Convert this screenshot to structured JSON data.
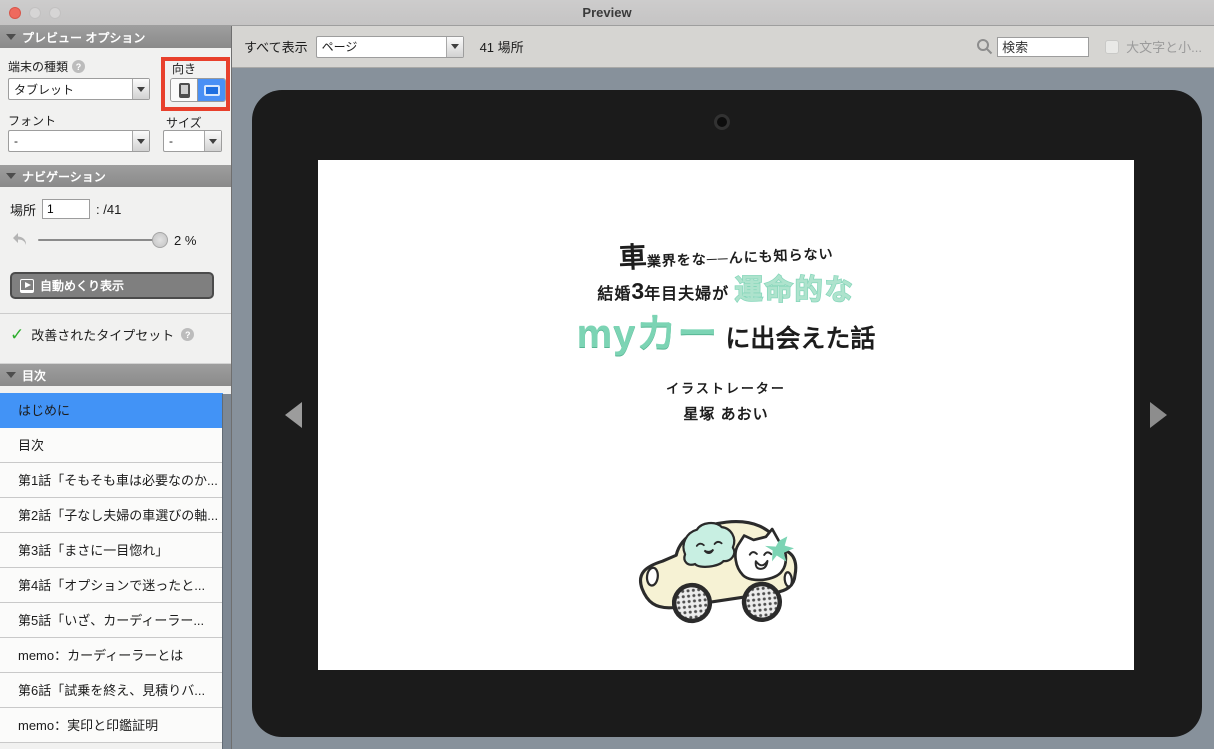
{
  "window": {
    "title": "Preview"
  },
  "sidebar": {
    "preview_options": {
      "header": "プレビュー オプション",
      "device_type_label": "端末の種類",
      "device_type_value": "タブレット",
      "orientation_label": "向き",
      "font_label": "フォント",
      "font_value": "-",
      "size_label": "サイズ",
      "size_value": "-"
    },
    "navigation": {
      "header": "ナビゲーション",
      "location_label": "場所",
      "location_value": "1",
      "location_total": ": /41",
      "progress_percent": "2 %",
      "auto_flip_button": "自動めくり表示",
      "typeset_label": "改善されたタイプセット"
    },
    "toc": {
      "header": "目次",
      "items": [
        {
          "label": "はじめに"
        },
        {
          "label": "目次"
        },
        {
          "label": "第1話「そもそも車は必要なのか..."
        },
        {
          "label": "第2話「子なし夫婦の車選びの軸..."
        },
        {
          "label": "第3話「まさに一目惚れ」"
        },
        {
          "label": "第4話「オプションで迷ったと..."
        },
        {
          "label": "第5話「いざ、カーディーラー..."
        },
        {
          "label": "memo：カーディーラーとは"
        },
        {
          "label": "第6話「試乗を終え、見積りバ..."
        },
        {
          "label": "memo：実印と印鑑証明"
        }
      ]
    }
  },
  "toolbar": {
    "show_all_label": "すべて表示",
    "view_mode_value": "ページ",
    "location_count": "41 場所",
    "search_value": "検索",
    "case_label": "大文字と小..."
  },
  "book_page": {
    "title_line1_big": "車",
    "title_line1_rest": "業界をな──んにも知らない",
    "title_line2_black_a": "結婚",
    "title_line2_num": "3",
    "title_line2_black_b": "年目夫婦が ",
    "title_line2_mint": "運命的な",
    "title_line3_mint": "myカー",
    "title_line3_black": " に出会えた話",
    "author_role": "イラストレーター",
    "author_name": "星塚 あおい"
  },
  "colors": {
    "selection_blue": "#4293f6",
    "annotation_red": "#e8402c",
    "mint_green": "#7cd4b4",
    "tablet_bezel": "#1b1b1b",
    "workspace_gray": "#87919b"
  }
}
